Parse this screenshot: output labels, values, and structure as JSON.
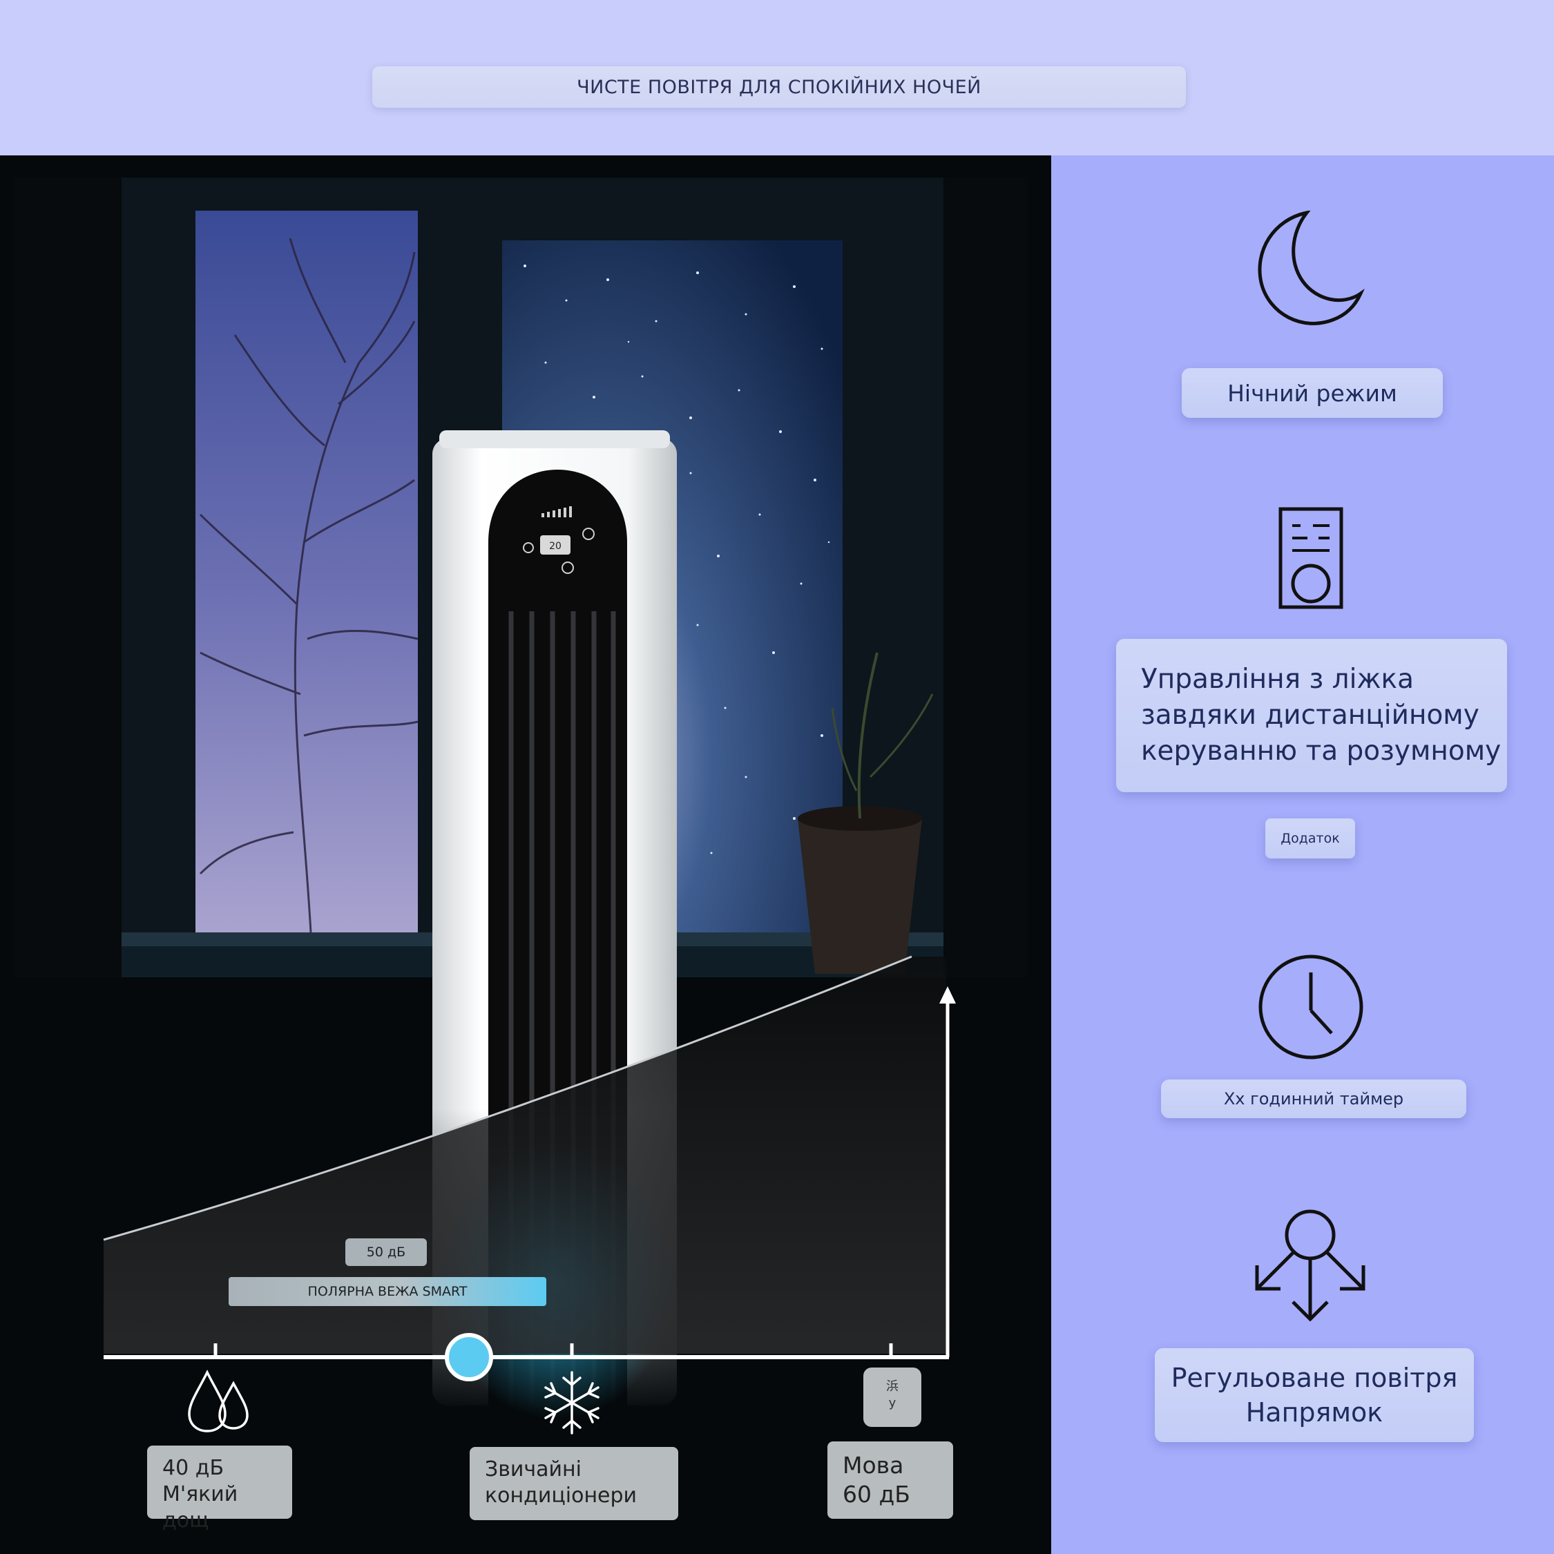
{
  "header": {
    "title": "ЧИСТЕ ПОВІТРЯ ДЛЯ СПОКІЙНИХ НОЧЕЙ"
  },
  "product": {
    "display_value": "20"
  },
  "chart": {
    "bubble_label": "50 дБ",
    "product_label": "ПОЛЯРНА ВЕЖА SMART",
    "markers": [
      {
        "icon": "raindrops-icon",
        "line1": "40 дБ",
        "line2": "М'який дощ"
      },
      {
        "icon": "snowflake-icon",
        "line1": "Звичайні",
        "line2": "кондиціонери"
      },
      {
        "icon": "language-icon",
        "glyph_top": "浜",
        "glyph_bottom": "у",
        "line1": "Мова",
        "line2": "60 дБ"
      }
    ]
  },
  "features": [
    {
      "icon": "moon-icon",
      "label": "Нічний режим"
    },
    {
      "icon": "remote-icon",
      "line1": "Управління з ліжка",
      "line2": "завдяки дистанційному",
      "line3": "керуванню та розумному",
      "sublabel": "Додаток"
    },
    {
      "icon": "clock-icon",
      "label": "Хх годинний таймер"
    },
    {
      "icon": "airflow-icon",
      "line1": "Регульоване повітря",
      "line2": "Напрямок"
    }
  ],
  "colors": {
    "accent": "#5ccbf2",
    "right_panel": "#a6adfb",
    "top_band": "#c8cdfb",
    "dark": "#05090b"
  }
}
